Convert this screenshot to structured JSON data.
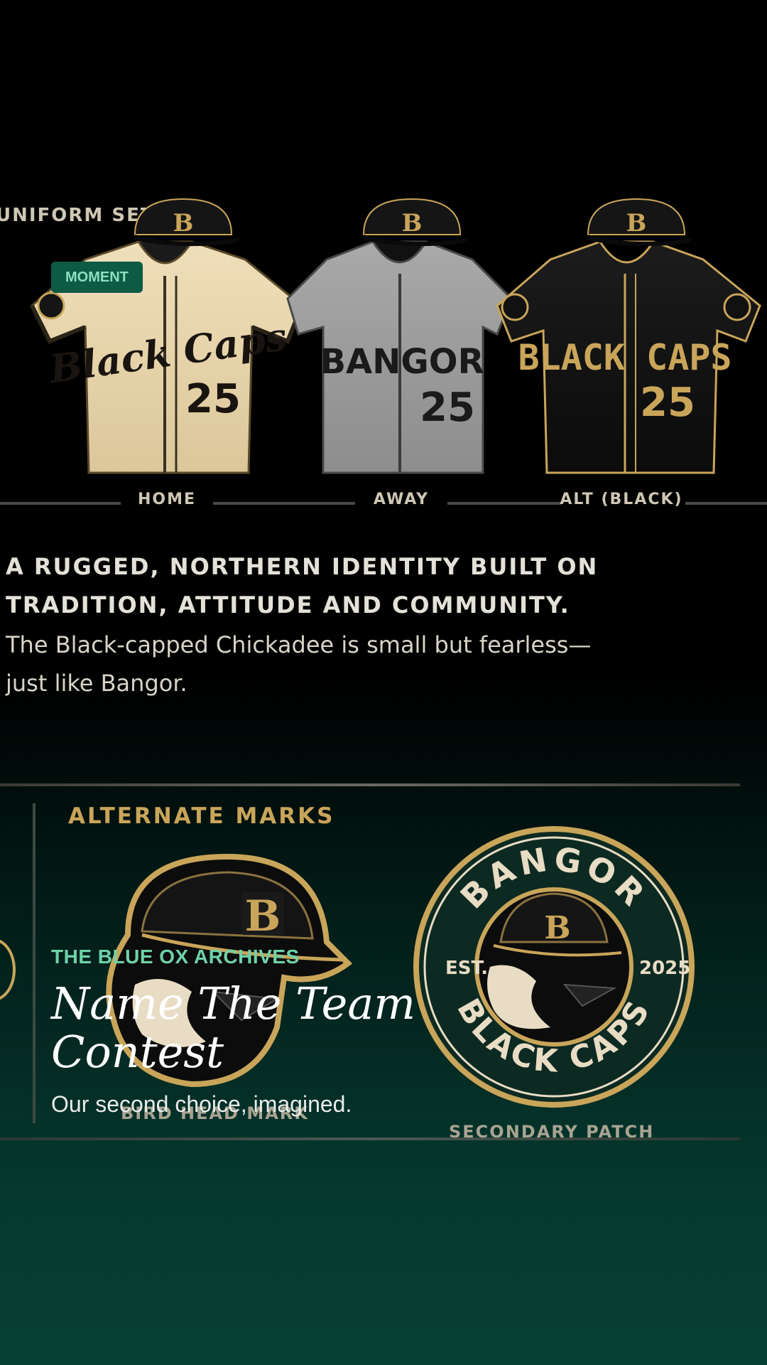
{
  "colors": {
    "gold": "#c9a55a",
    "cream": "#e9d8b0",
    "grey_jersey": "#9b9b9b",
    "black_jersey": "#111111",
    "tag_bg": "#0d5a45",
    "tag_text": "#8be0bf",
    "eyebrow": "#6fd2a8"
  },
  "uniform_set": {
    "section_label": "UNIFORM SET",
    "cap_letter": "B",
    "kits": [
      {
        "label": "HOME",
        "wordmark": "Black Caps",
        "number": "25"
      },
      {
        "label": "AWAY",
        "wordmark": "BANGOR",
        "number": "25"
      },
      {
        "label": "ALT (BLACK)",
        "wordmark": "BLACK CAPS",
        "number": "25"
      }
    ]
  },
  "tag": {
    "label": "MOMENT"
  },
  "identity": {
    "headline_line1": "A RUGGED, NORTHERN IDENTITY BUILT ON",
    "headline_line2": "TRADITION, ATTITUDE AND COMMUNITY.",
    "body_line1": "The Black-capped Chickadee is small but fearless—",
    "body_line2": "just like Bangor."
  },
  "alternate_marks": {
    "title": "ALTERNATE MARKS",
    "bird_head_caption": "BIRD HEAD MARK",
    "patch": {
      "top_text": "BANGOR",
      "bottom_text": "BLACK CAPS",
      "left_text": "EST.",
      "right_text": "2025",
      "caption": "SECONDARY PATCH"
    }
  },
  "story": {
    "eyebrow": "THE BLUE OX ARCHIVES",
    "title": "Name The Team Contest",
    "subtitle": "Our second choice, imagined."
  }
}
